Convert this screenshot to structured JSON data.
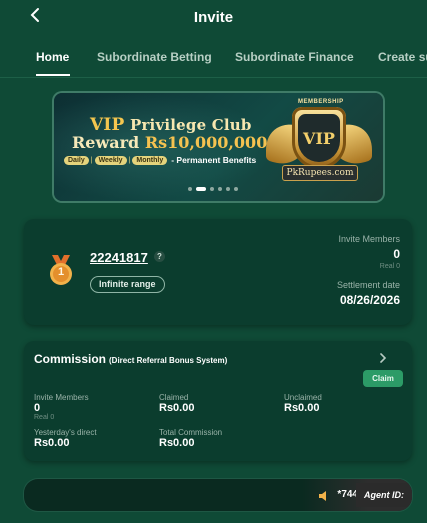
{
  "header": {
    "back_icon": "chevron-left-icon",
    "title": "Invite"
  },
  "tabs": [
    {
      "label": "Home",
      "active": true
    },
    {
      "label": "Subordinate Betting",
      "active": false
    },
    {
      "label": "Subordinate Finance",
      "active": false
    },
    {
      "label": "Create su",
      "active": false
    }
  ],
  "banner": {
    "title_prefix": "VIP",
    "title_rest": "Privilege Club",
    "reward_prefix": "Reward",
    "reward_amount": "Rs10,000,000",
    "chips": [
      "Daily",
      "Weekly",
      "Monthly"
    ],
    "benefits": "- Permanent Benefits",
    "badge_top": "MEMBERSHIP",
    "badge_text": "VIP",
    "site": "PkRupees.com",
    "slide_count": 6,
    "active_slide": 1
  },
  "invite_card": {
    "medal_icon": "rank-medal-icon",
    "medal_rank": "1",
    "invite_code": "22241817",
    "help_icon": "?",
    "range": "Infinite range",
    "invite_members_label": "Invite Members",
    "invite_members_value": "0",
    "real_label": "Real 0",
    "settlement_label": "Settlement date",
    "settlement_value": "08/26/2026"
  },
  "commission": {
    "title": "Commission",
    "subtitle": "(Direct Referral Bonus System)",
    "claim_button": "Claim",
    "invite_members_label": "Invite Members",
    "invite_members_value": "0",
    "real_label": "Real 0",
    "claimed_label": "Claimed",
    "claimed_value": "Rs0.00",
    "unclaimed_label": "Unclaimed",
    "unclaimed_value": "Rs0.00",
    "yesterday_label": "Yesterday's direct",
    "yesterday_value": "Rs0.00",
    "total_label": "Total Commission",
    "total_value": "Rs0.00"
  },
  "agent_bar": {
    "speaker_icon": "speaker-icon",
    "ticker_text": "*744",
    "agent_label": "Agent ID:"
  },
  "colors": {
    "background": "#0f4a36",
    "card": "#0b3d2e",
    "claim_button": "#2c9b67",
    "gold": "#f5c250"
  }
}
